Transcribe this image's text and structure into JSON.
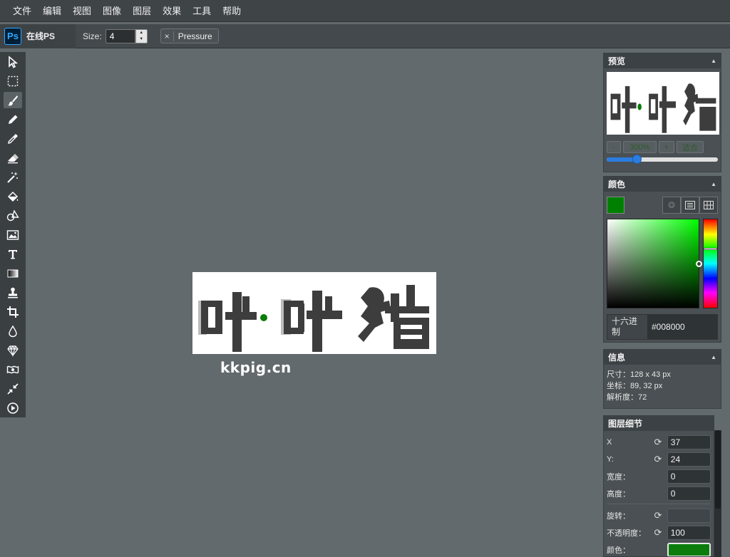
{
  "menu": [
    "文件",
    "编辑",
    "视图",
    "图像",
    "图层",
    "效果",
    "工具",
    "帮助"
  ],
  "app": {
    "name": "在线PS",
    "logo_text": "Ps"
  },
  "options": {
    "size_label": "Size:",
    "size_value": "4",
    "pressure_close": "×",
    "pressure_label": "Pressure"
  },
  "tools": [
    "select-arrow-icon",
    "marquee-icon",
    "brush-icon",
    "pencil-icon",
    "eyedropper-icon",
    "eraser-icon",
    "magic-wand-icon",
    "fill-icon",
    "shapes-icon",
    "image-icon",
    "text-icon",
    "gradient-icon",
    "stamp-icon",
    "crop-icon",
    "blur-drop-icon",
    "sharpen-icon",
    "bulge-icon",
    "shrink-icon",
    "play-icon"
  ],
  "canvas": {
    "text": "咔咔猪",
    "watermark": "kkpig.cn"
  },
  "preview": {
    "title": "预览",
    "zoom_out": "-",
    "zoom_value": "300%",
    "zoom_in": "+",
    "fit": "适合",
    "zoom_fraction": 0.27
  },
  "color": {
    "title": "颜色",
    "hex_label": "十六进制",
    "hex_value": "#008000",
    "swatch": "#008000"
  },
  "info": {
    "title": "信息",
    "size": "尺寸：128 x 43 px",
    "coords": "坐标：89, 32 px",
    "resolution": "解析度：72"
  },
  "layer": {
    "title": "图层细节",
    "x_label": "X",
    "x_value": "37",
    "y_label": "Y:",
    "y_value": "24",
    "width_label": "宽度：",
    "width_value": "0",
    "height_label": "高度：",
    "height_value": "0",
    "rotate_label": "旋转：",
    "rotate_value": "",
    "opacity_label": "不透明度：",
    "opacity_value": "100",
    "color_label": "颜色："
  },
  "colors": {
    "accent": "#2b7de0",
    "green": "#008000"
  }
}
